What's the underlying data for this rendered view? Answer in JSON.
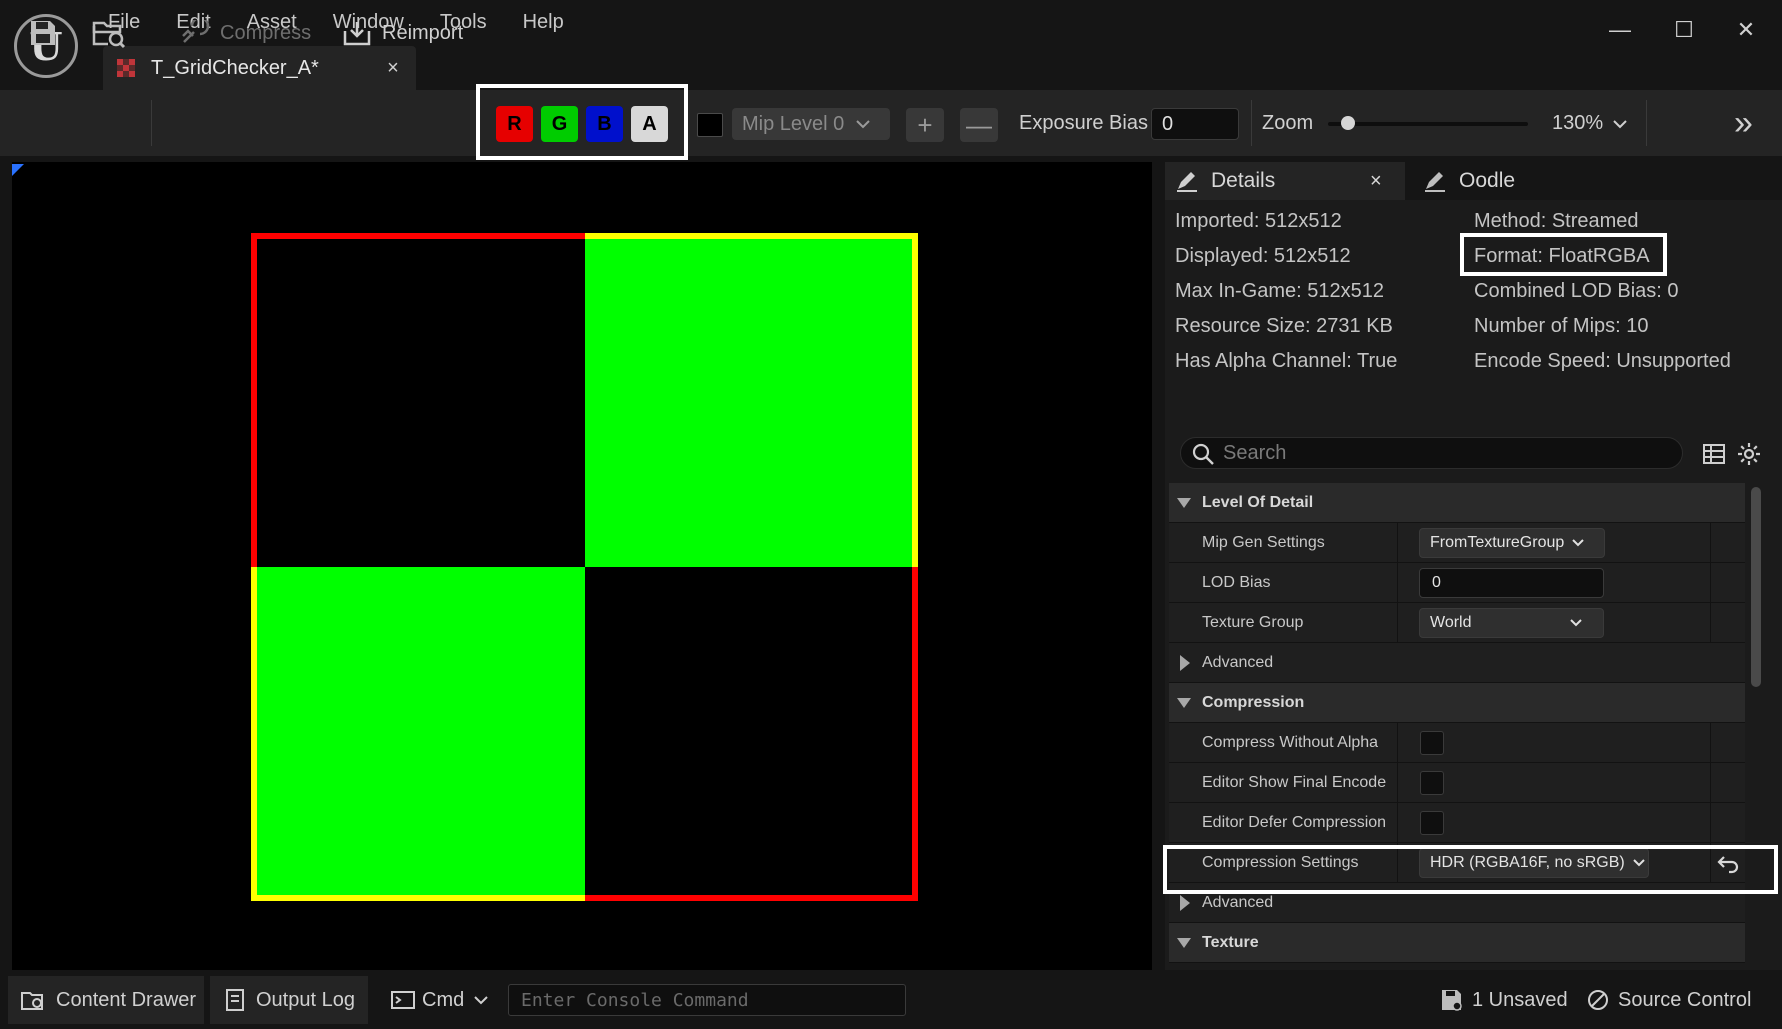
{
  "menu": [
    "File",
    "Edit",
    "Asset",
    "Window",
    "Tools",
    "Help"
  ],
  "document_tab": {
    "title": "T_GridChecker_A*",
    "close": "×"
  },
  "window_controls": {
    "minimize": "—",
    "maximize": "☐",
    "close": "✕"
  },
  "toolbar": {
    "compress_label": "Compress",
    "reimport_label": "Reimport",
    "channels": [
      {
        "label": "R",
        "color": "#e60000"
      },
      {
        "label": "G",
        "color": "#00cc00"
      },
      {
        "label": "B",
        "color": "#0010cc"
      },
      {
        "label": "A",
        "color": "#d8d8d8"
      }
    ],
    "mip_level": "Mip Level 0",
    "plus": "+",
    "minus": "—",
    "exposure_label": "Exposure Bias",
    "exposure_value": "0",
    "zoom_label": "Zoom",
    "zoom_value": "130%",
    "zoom_fraction": 0.1,
    "overflow": "»"
  },
  "viewport": {
    "checker_colors": {
      "green": "#00ff00",
      "black": "#000000",
      "red": "#ff0000",
      "yellow": "#ffff00"
    }
  },
  "panel_tabs": {
    "details": "Details",
    "details_close": "×",
    "oodle": "Oodle"
  },
  "info": {
    "left": [
      "Imported: 512x512",
      "Displayed: 512x512",
      "Max In-Game: 512x512",
      "Resource Size: 2731 KB",
      "Has Alpha Channel: True"
    ],
    "right": [
      "Method: Streamed",
      "Format: FloatRGBA",
      "Combined LOD Bias: 0",
      "Number of Mips: 10",
      "Encode Speed: Unsupported"
    ]
  },
  "search": {
    "placeholder": "Search"
  },
  "properties": {
    "level_of_detail": "Level Of Detail",
    "mip_gen_settings": {
      "name": "Mip Gen Settings",
      "value": "FromTextureGroup"
    },
    "lod_bias": {
      "name": "LOD Bias",
      "value": "0"
    },
    "texture_group": {
      "name": "Texture Group",
      "value": "World"
    },
    "advanced_1": "Advanced",
    "compression": "Compression",
    "compress_without_alpha": "Compress Without Alpha",
    "editor_show_final_encode": "Editor Show Final Encode",
    "editor_defer_compression": "Editor Defer Compression",
    "compression_settings": {
      "name": "Compression Settings",
      "value": "HDR (RGBA16F, no sRGB)"
    },
    "advanced_2": "Advanced",
    "texture": "Texture"
  },
  "statusbar": {
    "content_drawer": "Content Drawer",
    "output_log": "Output Log",
    "cmd": "Cmd",
    "console_placeholder": "Enter Console Command",
    "unsaved": "1 Unsaved",
    "source_control": "Source Control"
  }
}
